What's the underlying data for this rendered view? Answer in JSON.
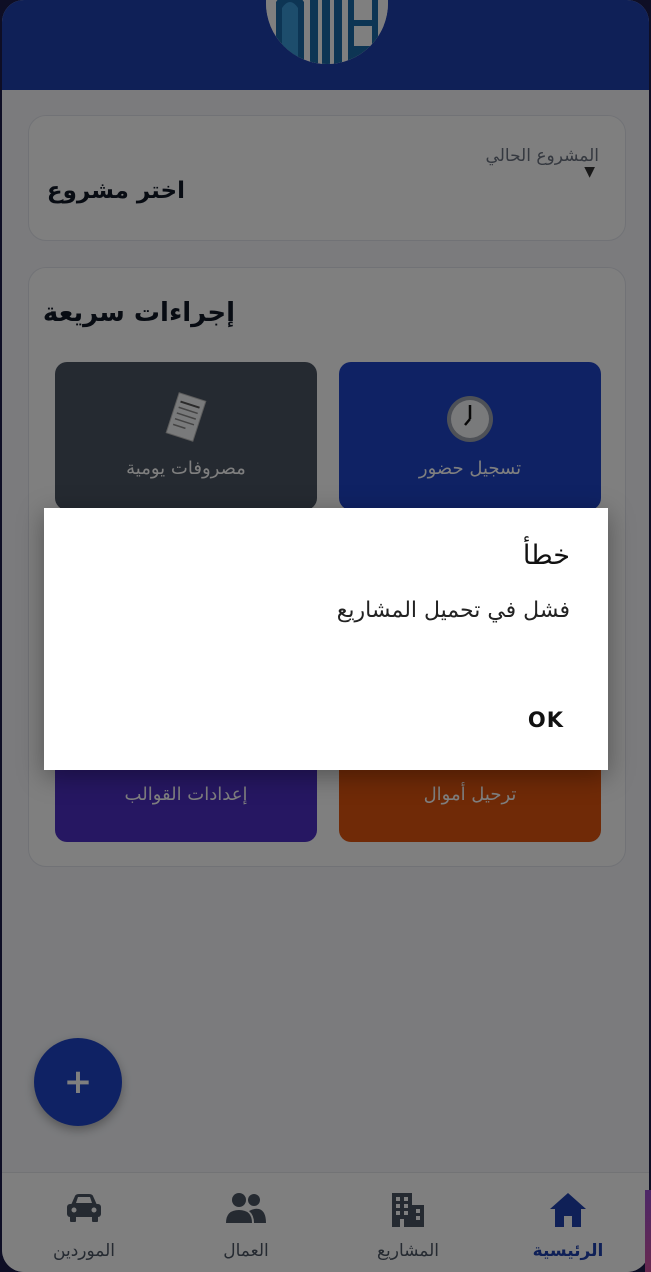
{
  "colors": {
    "primary": "#1e40af",
    "attendance": "#1f45c8",
    "expenses": "#4b5563",
    "transfer": "#e0540f",
    "templates": "#4c2fc4"
  },
  "project_selector": {
    "label": "المشروع الحالي",
    "value": "اختر مشروع",
    "icon": "dropdown-arrow-icon"
  },
  "quick_actions": {
    "title": "إجراءات سريعة",
    "items": [
      {
        "label": "تسجيل حضور",
        "icon": "clock-icon"
      },
      {
        "label": "مصروفات يومية",
        "icon": "receipt-icon"
      },
      {
        "label": "ترحيل أموال",
        "icon": ""
      },
      {
        "label": "إعدادات القوالب",
        "icon": ""
      }
    ]
  },
  "fab": {
    "label": "+",
    "icon": "plus-icon"
  },
  "bottom_nav": {
    "items": [
      {
        "label": "الرئيسية",
        "icon": "home-icon",
        "active": true
      },
      {
        "label": "المشاريع",
        "icon": "building-icon",
        "active": false
      },
      {
        "label": "العمال",
        "icon": "people-icon",
        "active": false
      },
      {
        "label": "الموردين",
        "icon": "car-icon",
        "active": false
      }
    ]
  },
  "dialog": {
    "title": "خطأ",
    "message": "فشل في تحميل المشاريع",
    "ok_label": "OK"
  }
}
